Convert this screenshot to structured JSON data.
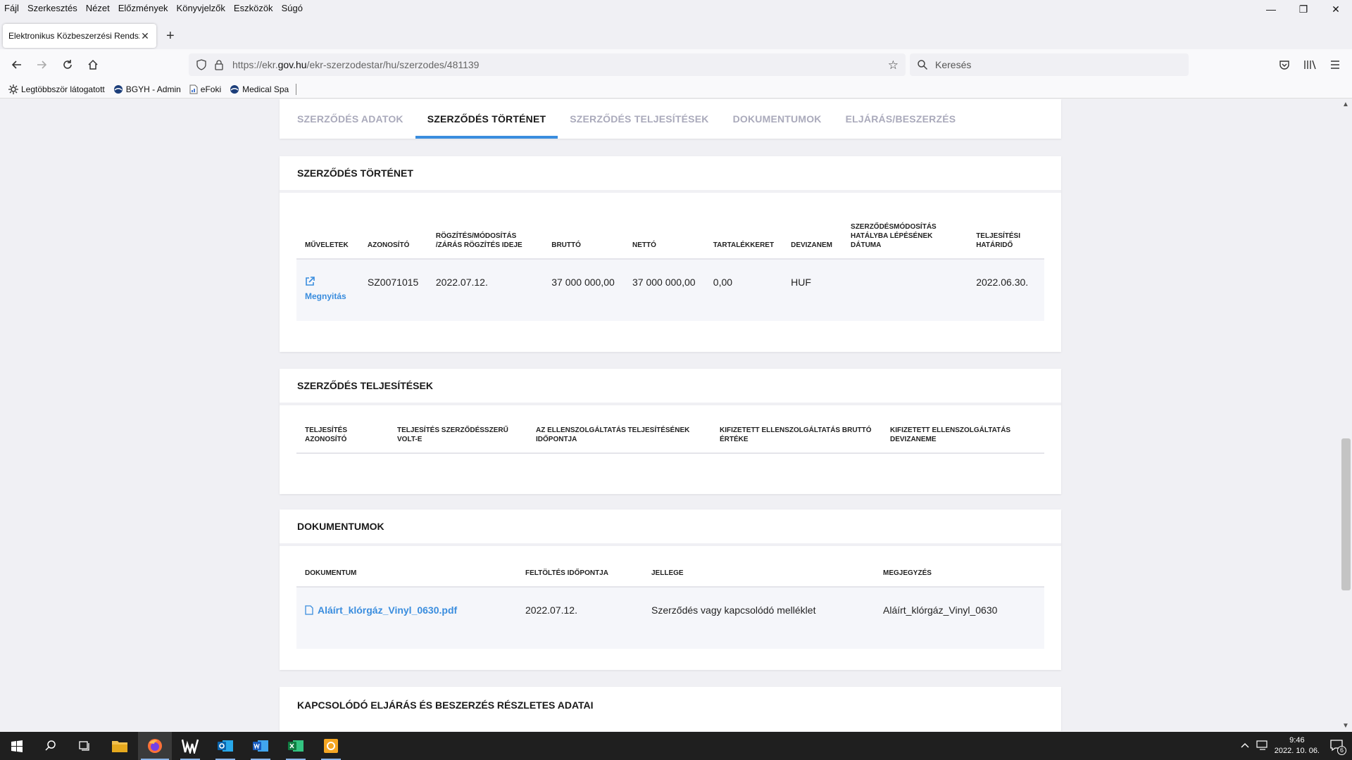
{
  "menubar": {
    "items": [
      "Fájl",
      "Szerkesztés",
      "Nézet",
      "Előzmények",
      "Könyvjelzők",
      "Eszközök",
      "Súgó"
    ]
  },
  "window_controls": {
    "minimize": "—",
    "restore": "❐",
    "close": "✕"
  },
  "browser_tab": {
    "title": "Elektronikus Közbeszerzési Rendszer",
    "close": "✕",
    "new_tab": "+"
  },
  "address": {
    "prefix": "https://ekr.",
    "host": "gov.hu",
    "path": "/ekr-szerzodestar/hu/szerzodes/481139"
  },
  "search": {
    "placeholder": "Keresés"
  },
  "bookmarks": [
    {
      "label": "Legtöbbször látogatott",
      "icon": "gear-icon"
    },
    {
      "label": "BGYH - Admin",
      "icon": "globe-icon"
    },
    {
      "label": "eFoki",
      "icon": "page-icon"
    },
    {
      "label": "Medical Spa",
      "icon": "globe-icon"
    }
  ],
  "page_tabs": [
    {
      "label": "SZERZŐDÉS ADATOK",
      "active": false
    },
    {
      "label": "SZERZŐDÉS TÖRTÉNET",
      "active": true
    },
    {
      "label": "SZERZŐDÉS TELJESÍTÉSEK",
      "active": false
    },
    {
      "label": "DOKUMENTUMOK",
      "active": false
    },
    {
      "label": "ELJÁRÁS/BESZERZÉS",
      "active": false
    }
  ],
  "history": {
    "title": "SZERZŐDÉS TÖRTÉNET",
    "columns": [
      "MŰVELETEK",
      "AZONOSÍTÓ",
      "RÖGZÍTÉS/MÓDOSÍTÁS /ZÁRÁS RÖGZÍTÉS IDEJE",
      "BRUTTÓ",
      "NETTÓ",
      "TARTALÉKKERET",
      "DEVIZANEM",
      "SZERZŐDÉSMÓDOSÍTÁS HATÁLYBA LÉPÉSÉNEK DÁTUMA",
      "TELJESÍTÉSI HATÁRIDŐ"
    ],
    "rows": [
      {
        "action": "Megnyitás",
        "id": "SZ0071015",
        "recorded": "2022.07.12.",
        "gross": "37 000 000,00",
        "net": "37 000 000,00",
        "reserve": "0,00",
        "currency": "HUF",
        "amendment_date": "",
        "deadline": "2022.06.30."
      }
    ]
  },
  "fulfillment": {
    "title": "SZERZŐDÉS TELJESÍTÉSEK",
    "columns": [
      "TELJESÍTÉS AZONOSÍTÓ",
      "TELJESÍTÉS SZERZŐDÉSSZERŰ VOLT-E",
      "AZ ELLENSZOLGÁLTATÁS TELJESÍTÉSÉNEK IDŐPONTJA",
      "KIFIZETETT ELLENSZOLGÁLTATÁS BRUTTÓ ÉRTÉKE",
      "KIFIZETETT ELLENSZOLGÁLTATÁS DEVIZANEME"
    ]
  },
  "documents": {
    "title": "DOKUMENTUMOK",
    "columns": [
      "DOKUMENTUM",
      "FELTÖLTÉS IDŐPONTJA",
      "JELLEGE",
      "MEGJEGYZÉS"
    ],
    "rows": [
      {
        "file": "Aláírt_klórgáz_Vinyl_0630.pdf",
        "uploaded": "2022.07.12.",
        "type": "Szerződés vagy kapcsolódó melléklet",
        "note": "Aláírt_klórgáz_Vinyl_0630"
      }
    ]
  },
  "related": {
    "title": "KAPCSOLÓDÓ ELJÁRÁS ÉS BESZERZÉS RÉSZLETES ADATAI"
  },
  "taskbar": {
    "time": "9:46",
    "date": "2022. 10. 06.",
    "notifications": "6"
  },
  "colors": {
    "accent": "#3a8dde",
    "page_bg": "#f0f0f4",
    "taskbar": "#1f1f1f"
  }
}
